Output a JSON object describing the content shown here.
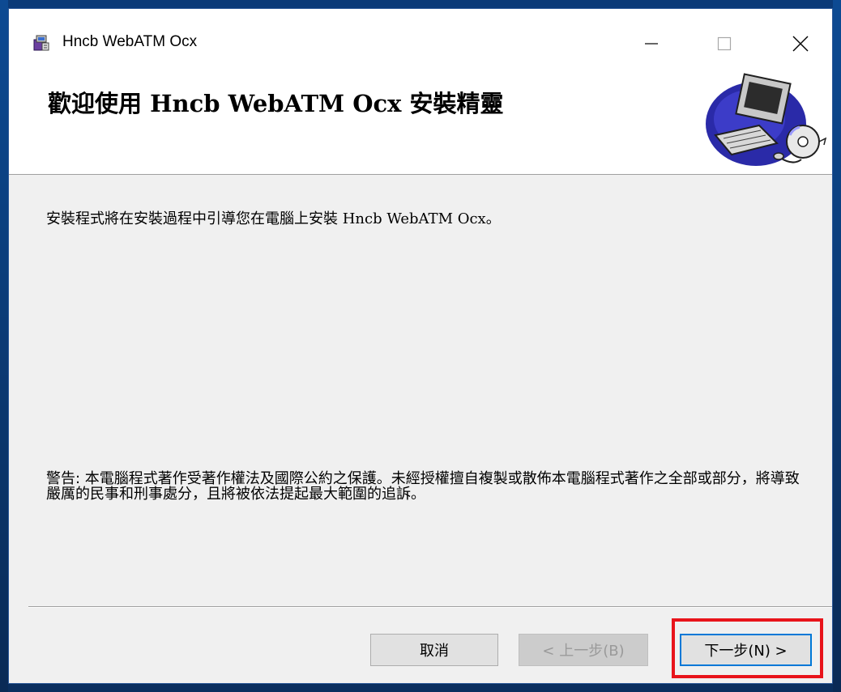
{
  "window": {
    "title": "Hncb WebATM Ocx",
    "accent_color": "#0078d7"
  },
  "titlebar": {
    "icon": "installer-package-icon",
    "minimize_icon": "minimize-icon",
    "maximize_icon": "maximize-icon",
    "close_icon": "close-icon"
  },
  "banner": {
    "title": "歡迎使用 Hncb WebATM Ocx 安裝精靈",
    "graphic": "computer-with-disc-icon"
  },
  "content": {
    "intro": "安裝程式將在安裝過程中引導您在電腦上安裝 Hncb WebATM Ocx。",
    "warning": "警告: 本電腦程式著作受著作權法及國際公約之保護。未經授權擅自複製或散佈本電腦程式著作之全部或部分，將導致嚴厲的民事和刑事處分，且將被依法提起最大範圍的追訴。"
  },
  "buttons": {
    "cancel": "取消",
    "back": "< 上一步(B)",
    "next": "下一步(N) >",
    "back_enabled": false
  },
  "annotation": {
    "highlight_color": "#e8141b",
    "highlight_target": "next-button"
  }
}
